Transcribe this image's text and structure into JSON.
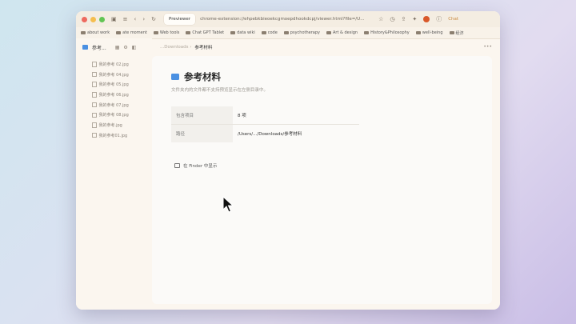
{
  "browser": {
    "tab_title": "Previewer",
    "url": "chrome-extension://ehpebkbieoekcgmoepdhookdcpj/viewer.html?file=/U...",
    "chat_label": "Chat"
  },
  "bookmarks": [
    "about work",
    "ate moment",
    "Web tools",
    "Chat GPT Tablet",
    "data wiki",
    "code",
    "psychotherapy",
    "Art & design",
    "History&Philosophy",
    "well-being",
    "经济"
  ],
  "sidebar": {
    "folder_title": "参考...",
    "files": [
      "我的参考 02.jpg",
      "我的参考 04.jpg",
      "我的参考 05.jpg",
      "我的参考 06.jpg",
      "我的参考 07.jpg",
      "我的参考 08.jpg",
      "我的参考.jpg",
      "我的参考01.jpg"
    ]
  },
  "breadcrumb": {
    "parent": "...Downloads",
    "current": "参考材料"
  },
  "main": {
    "title": "参考材料",
    "description": "文件夹内的文件都不支持预览显示在左侧目录中。",
    "info": [
      {
        "key": "包含项目",
        "value": "8 项"
      },
      {
        "key": "路径",
        "value": "/Users/.../Downloads/参考材料"
      }
    ],
    "finder_label": "在 Finder 中显示"
  },
  "colors": {
    "accent": "#4a90e2",
    "window_bg": "#fbf6ef",
    "content_bg": "#fbfaf8"
  }
}
